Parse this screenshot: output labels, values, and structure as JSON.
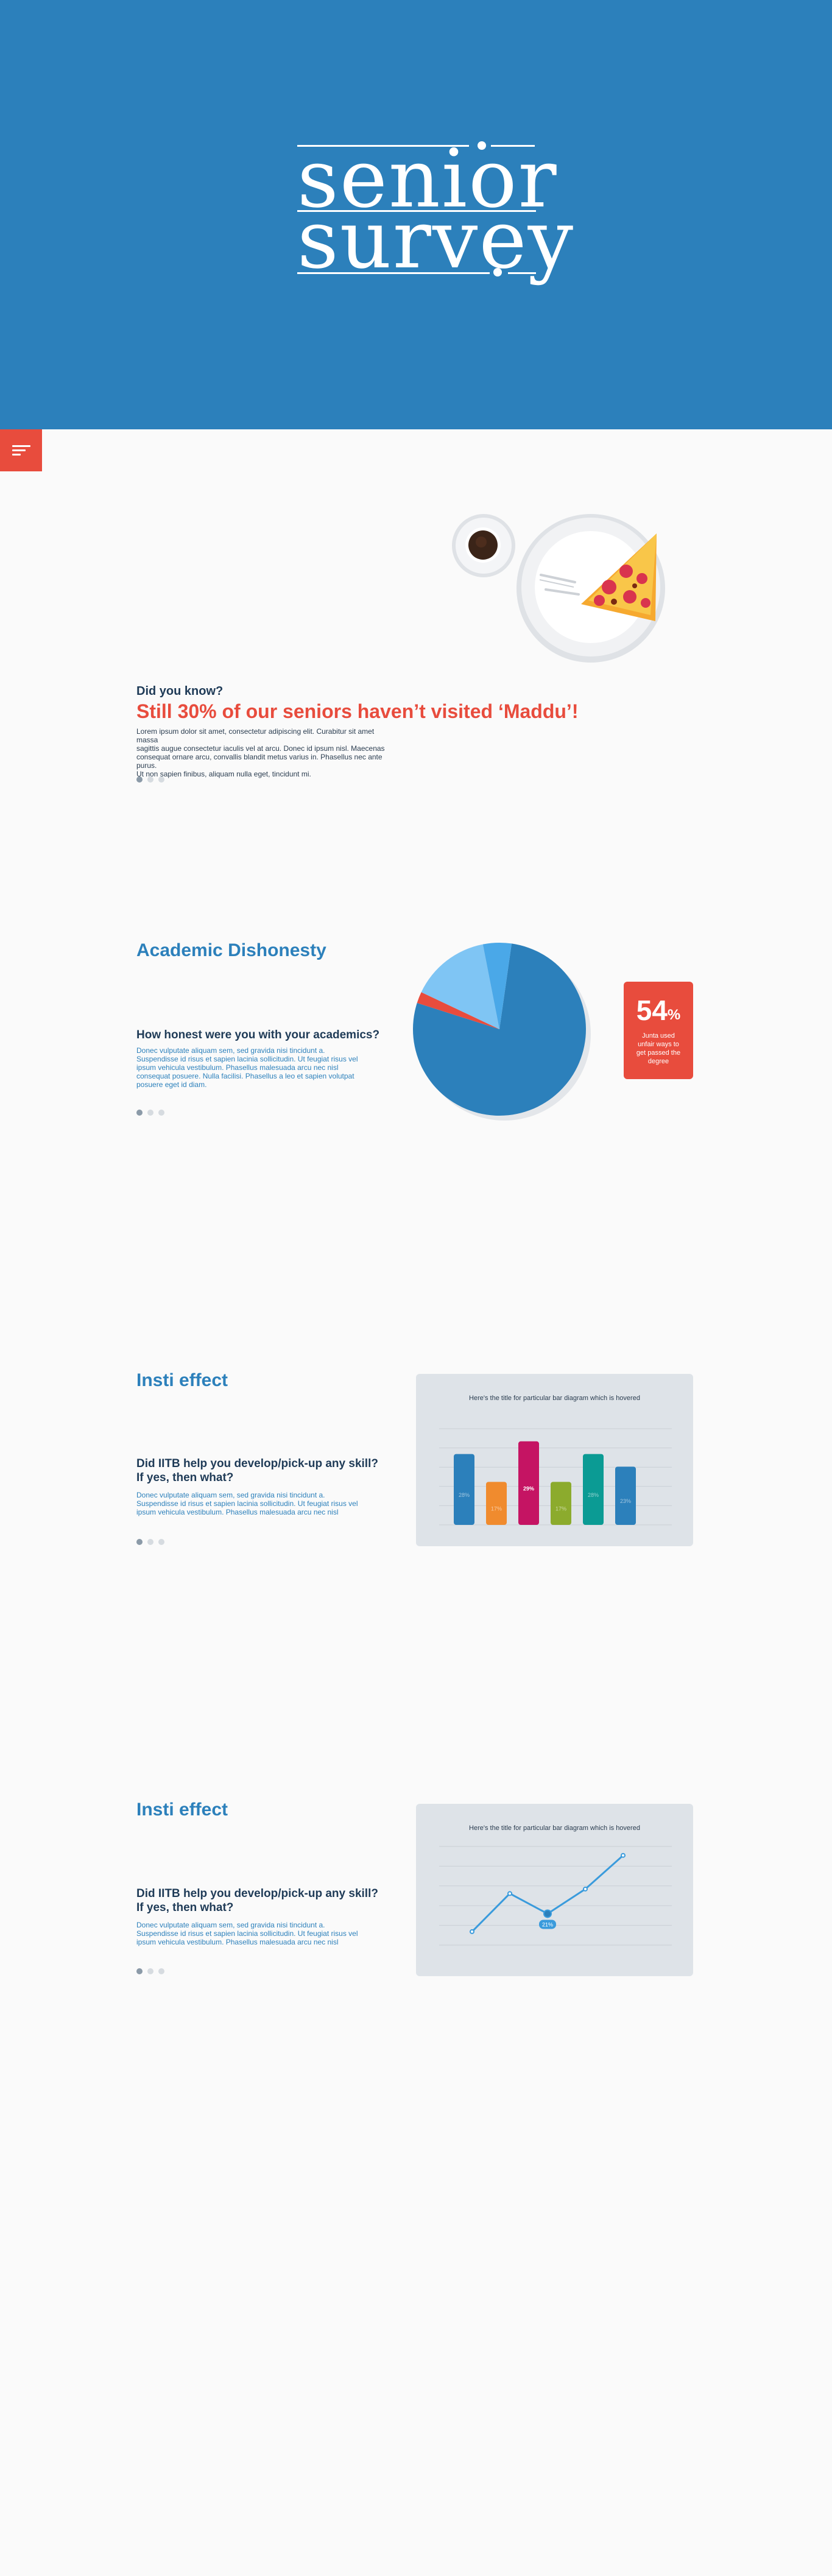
{
  "hero": {
    "word1": "senior",
    "word2": "survey",
    "background": "#2c80bb"
  },
  "menu": {
    "icon": "menu-icon",
    "color": "#e84c3d"
  },
  "did_you_know": {
    "kicker": "Did you know?",
    "headline": "Still 30% of our seniors haven’t visited ‘Maddu’!",
    "body_lines": [
      "Lorem ipsum dolor sit amet, consectetur adipiscing elit. Curabitur sit amet massa",
      "sagittis augue consectetur iaculis vel at arcu. Donec id ipsum nisl. Maecenas",
      "consequat ornare arcu, convallis blandit metus varius in. Phasellus nec ante purus.",
      "Ut non sapien finibus, aliquam nulla eget, tincidunt mi."
    ],
    "illustration": [
      "coffee-cup-icon",
      "pizza-plate-icon"
    ]
  },
  "academic": {
    "title": "Academic Dishonesty",
    "question": "How honest were you with your academics?",
    "body_lines": [
      "Donec vulputate aliquam sem, sed gravida nisi tincidunt a.",
      "Suspendisse id risus et sapien lacinia sollicitudin. Ut feugiat risus vel",
      "ipsum vehicula vestibulum. Phasellus malesuada arcu nec nisl",
      "consequat posuere. Nulla facilisi. Phasellus a leo et sapien volutpat",
      "posuere eget id diam."
    ],
    "stat_value": "54",
    "stat_unit": "%",
    "stat_caption": "Junta used unfair ways to get passed the degree",
    "chart_data": {
      "type": "pie",
      "values": [
        73,
        2,
        14,
        5
      ],
      "colors": [
        "#2c80bb",
        "#e84c3d",
        "#7fc5f4",
        "#4aa8e8"
      ],
      "shadow": "#e3e6ea"
    }
  },
  "insti_bar": {
    "title": "Insti effect",
    "question": "Did IITB help you develop/pick-up any skill? If yes, then what?",
    "body_lines": [
      "Donec vulputate aliquam sem, sed gravida nisi tincidunt a.",
      "Suspendisse id risus et sapien lacinia sollicitudin. Ut feugiat risus vel",
      "ipsum vehicula vestibulum. Phasellus malesuada arcu nec nisl"
    ],
    "chart_title": "Here's the title for particular bar diagram which is hovered",
    "chart_data": {
      "type": "bar",
      "values": [
        28,
        17,
        33,
        17,
        28,
        23
      ],
      "labels": [
        "28%",
        "17%",
        "29%",
        "17%",
        "28%",
        "23%"
      ],
      "colors": [
        "#2c80bb",
        "#f08b2e",
        "#c51463",
        "#8cab2d",
        "#0b9b94",
        "#2c80bb"
      ],
      "highlight_index": 2,
      "ylim": [
        0,
        38
      ]
    }
  },
  "insti_line": {
    "title": "Insti effect",
    "question": "Did IITB help you develop/pick-up any skill? If yes, then what?",
    "body_lines": [
      "Donec vulputate aliquam sem, sed gravida nisi tincidunt a.",
      "Suspendisse id risus et sapien lacinia sollicitudin. Ut feugiat risus vel",
      "ipsum vehicula vestibulum. Phasellus malesuada arcu nec nisl"
    ],
    "chart_title": "Here's the title for particular bar diagram which is hovered",
    "chart_data": {
      "type": "line",
      "values": [
        6,
        23,
        14,
        25,
        40
      ],
      "highlight_index": 2,
      "highlight_label": "21%",
      "ylim": [
        0,
        44
      ],
      "color": "#3a9bdc"
    }
  }
}
